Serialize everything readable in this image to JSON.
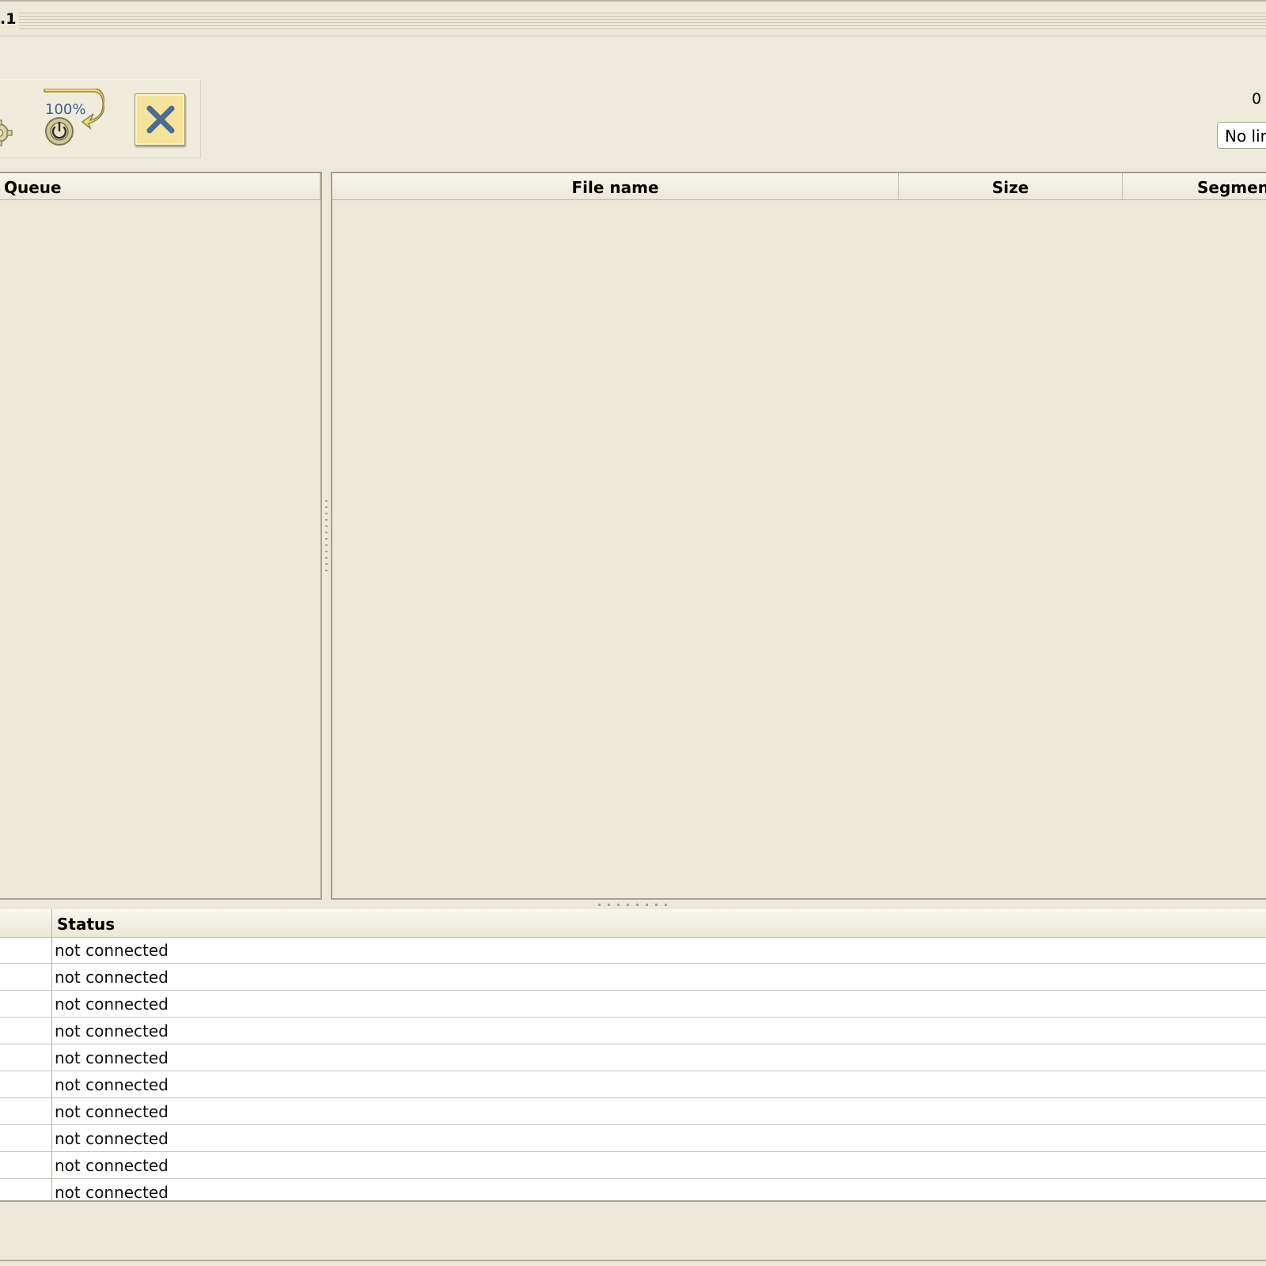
{
  "window": {
    "title": ".1"
  },
  "toolbar": {
    "settings_icon": "gear-icon",
    "auto_shutdown_icon": "auto-shutdown-icon",
    "auto_shutdown_label": "100%",
    "cancel_icon": "close-icon"
  },
  "speed": {
    "value": "0",
    "limit_selected": "No lim"
  },
  "queue": {
    "header": "Queue"
  },
  "files": {
    "columns": [
      {
        "label": "File name"
      },
      {
        "label": "Size"
      },
      {
        "label": "Segments"
      }
    ]
  },
  "connections": {
    "header": "Status",
    "rows": [
      {
        "status": "not connected"
      },
      {
        "status": "not connected"
      },
      {
        "status": "not connected"
      },
      {
        "status": "not connected"
      },
      {
        "status": "not connected"
      },
      {
        "status": "not connected"
      },
      {
        "status": "not connected"
      },
      {
        "status": "not connected"
      },
      {
        "status": "not connected"
      },
      {
        "status": "not connected"
      }
    ]
  },
  "colors": {
    "background": "#ece9d8",
    "cancel_button": "#f4e39a",
    "cancel_x": "#4a6e93",
    "icon_power": "#c9c48e"
  }
}
